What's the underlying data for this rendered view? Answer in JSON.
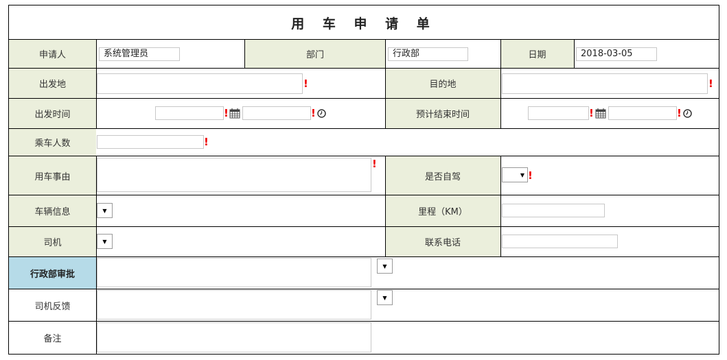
{
  "form_title": "用 车 申 请 单",
  "fields": {
    "applicant": {
      "label": "申请人",
      "value": "系统管理员"
    },
    "department": {
      "label": "部门",
      "value": "行政部"
    },
    "date": {
      "label": "日期",
      "value": "2018-03-05"
    },
    "origin": {
      "label": "出发地",
      "value": ""
    },
    "destination": {
      "label": "目的地",
      "value": ""
    },
    "depart_time": {
      "label": "出发时间",
      "date_value": "",
      "time_value": ""
    },
    "end_time": {
      "label": "预计结束时间",
      "date_value": "",
      "time_value": ""
    },
    "passengers": {
      "label": "乘车人数",
      "value": ""
    },
    "reason": {
      "label": "用车事由",
      "value": ""
    },
    "self_drive": {
      "label": "是否自驾",
      "selected": ""
    },
    "vehicle": {
      "label": "车辆信息",
      "selected": ""
    },
    "mileage": {
      "label": "里程（KM）",
      "value": ""
    },
    "driver": {
      "label": "司机",
      "selected": ""
    },
    "phone": {
      "label": "联系电话",
      "value": ""
    },
    "admin_approval": {
      "label": "行政部审批",
      "value": ""
    },
    "driver_feedback": {
      "label": "司机反馈",
      "value": ""
    },
    "remarks": {
      "label": "备注",
      "value": ""
    }
  },
  "icons": {
    "required": "required-mark-icon",
    "calendar": "calendar-icon",
    "clock": "clock-icon",
    "dropdown": "dropdown-arrow-icon"
  },
  "colors": {
    "label_bg": "#ebefdc",
    "approval_label_bg": "#b6dbe8",
    "required": "#e00000"
  },
  "required_mark": "!",
  "dropdown_arrow": "▼"
}
